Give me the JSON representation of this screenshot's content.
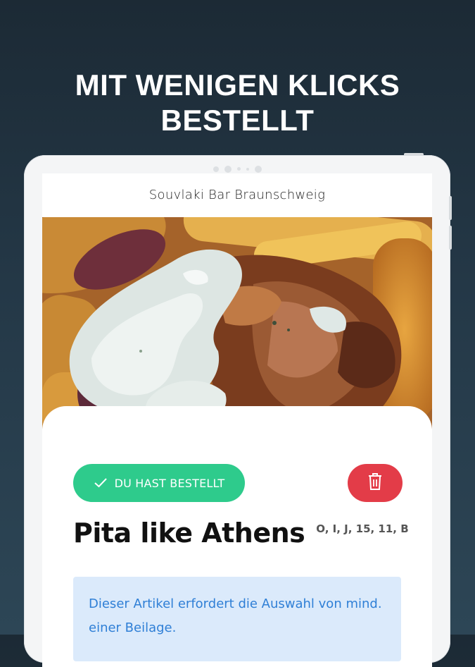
{
  "headline": {
    "line1": "MIT WENIGEN KLICKS",
    "line2": "BESTELLT"
  },
  "store": {
    "name": "Souvlaki Bar Braunschweig"
  },
  "item": {
    "ordered_label": "DU HAST BESTELLT",
    "title": "Pita like Athens",
    "allergens": "O, I, J, 15, 11, B",
    "notice": "Dieser Artikel erfordert die Auswahl von mind. einer Beilage."
  },
  "icons": {
    "ordered": "checkmark-icon",
    "delete": "trash-icon"
  },
  "colors": {
    "background": "#1c2a35",
    "ordered_pill": "#2ecb8c",
    "delete_button": "#e33c48",
    "notice_bg": "#dbeafb",
    "notice_text": "#2f7fd6"
  }
}
